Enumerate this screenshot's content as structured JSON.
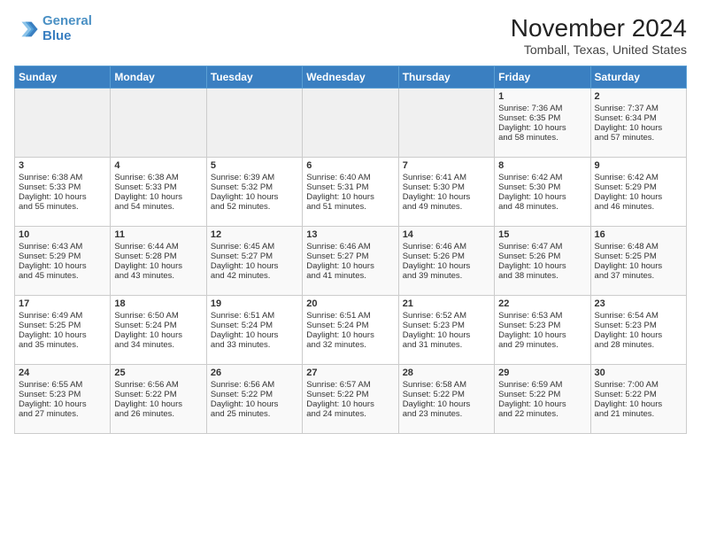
{
  "header": {
    "logo_line1": "General",
    "logo_line2": "Blue",
    "month": "November 2024",
    "location": "Tomball, Texas, United States"
  },
  "weekdays": [
    "Sunday",
    "Monday",
    "Tuesday",
    "Wednesday",
    "Thursday",
    "Friday",
    "Saturday"
  ],
  "weeks": [
    [
      {
        "day": "",
        "info": ""
      },
      {
        "day": "",
        "info": ""
      },
      {
        "day": "",
        "info": ""
      },
      {
        "day": "",
        "info": ""
      },
      {
        "day": "",
        "info": ""
      },
      {
        "day": "1",
        "info": "Sunrise: 7:36 AM\nSunset: 6:35 PM\nDaylight: 10 hours\nand 58 minutes."
      },
      {
        "day": "2",
        "info": "Sunrise: 7:37 AM\nSunset: 6:34 PM\nDaylight: 10 hours\nand 57 minutes."
      }
    ],
    [
      {
        "day": "3",
        "info": "Sunrise: 6:38 AM\nSunset: 5:33 PM\nDaylight: 10 hours\nand 55 minutes."
      },
      {
        "day": "4",
        "info": "Sunrise: 6:38 AM\nSunset: 5:33 PM\nDaylight: 10 hours\nand 54 minutes."
      },
      {
        "day": "5",
        "info": "Sunrise: 6:39 AM\nSunset: 5:32 PM\nDaylight: 10 hours\nand 52 minutes."
      },
      {
        "day": "6",
        "info": "Sunrise: 6:40 AM\nSunset: 5:31 PM\nDaylight: 10 hours\nand 51 minutes."
      },
      {
        "day": "7",
        "info": "Sunrise: 6:41 AM\nSunset: 5:30 PM\nDaylight: 10 hours\nand 49 minutes."
      },
      {
        "day": "8",
        "info": "Sunrise: 6:42 AM\nSunset: 5:30 PM\nDaylight: 10 hours\nand 48 minutes."
      },
      {
        "day": "9",
        "info": "Sunrise: 6:42 AM\nSunset: 5:29 PM\nDaylight: 10 hours\nand 46 minutes."
      }
    ],
    [
      {
        "day": "10",
        "info": "Sunrise: 6:43 AM\nSunset: 5:29 PM\nDaylight: 10 hours\nand 45 minutes."
      },
      {
        "day": "11",
        "info": "Sunrise: 6:44 AM\nSunset: 5:28 PM\nDaylight: 10 hours\nand 43 minutes."
      },
      {
        "day": "12",
        "info": "Sunrise: 6:45 AM\nSunset: 5:27 PM\nDaylight: 10 hours\nand 42 minutes."
      },
      {
        "day": "13",
        "info": "Sunrise: 6:46 AM\nSunset: 5:27 PM\nDaylight: 10 hours\nand 41 minutes."
      },
      {
        "day": "14",
        "info": "Sunrise: 6:46 AM\nSunset: 5:26 PM\nDaylight: 10 hours\nand 39 minutes."
      },
      {
        "day": "15",
        "info": "Sunrise: 6:47 AM\nSunset: 5:26 PM\nDaylight: 10 hours\nand 38 minutes."
      },
      {
        "day": "16",
        "info": "Sunrise: 6:48 AM\nSunset: 5:25 PM\nDaylight: 10 hours\nand 37 minutes."
      }
    ],
    [
      {
        "day": "17",
        "info": "Sunrise: 6:49 AM\nSunset: 5:25 PM\nDaylight: 10 hours\nand 35 minutes."
      },
      {
        "day": "18",
        "info": "Sunrise: 6:50 AM\nSunset: 5:24 PM\nDaylight: 10 hours\nand 34 minutes."
      },
      {
        "day": "19",
        "info": "Sunrise: 6:51 AM\nSunset: 5:24 PM\nDaylight: 10 hours\nand 33 minutes."
      },
      {
        "day": "20",
        "info": "Sunrise: 6:51 AM\nSunset: 5:24 PM\nDaylight: 10 hours\nand 32 minutes."
      },
      {
        "day": "21",
        "info": "Sunrise: 6:52 AM\nSunset: 5:23 PM\nDaylight: 10 hours\nand 31 minutes."
      },
      {
        "day": "22",
        "info": "Sunrise: 6:53 AM\nSunset: 5:23 PM\nDaylight: 10 hours\nand 29 minutes."
      },
      {
        "day": "23",
        "info": "Sunrise: 6:54 AM\nSunset: 5:23 PM\nDaylight: 10 hours\nand 28 minutes."
      }
    ],
    [
      {
        "day": "24",
        "info": "Sunrise: 6:55 AM\nSunset: 5:23 PM\nDaylight: 10 hours\nand 27 minutes."
      },
      {
        "day": "25",
        "info": "Sunrise: 6:56 AM\nSunset: 5:22 PM\nDaylight: 10 hours\nand 26 minutes."
      },
      {
        "day": "26",
        "info": "Sunrise: 6:56 AM\nSunset: 5:22 PM\nDaylight: 10 hours\nand 25 minutes."
      },
      {
        "day": "27",
        "info": "Sunrise: 6:57 AM\nSunset: 5:22 PM\nDaylight: 10 hours\nand 24 minutes."
      },
      {
        "day": "28",
        "info": "Sunrise: 6:58 AM\nSunset: 5:22 PM\nDaylight: 10 hours\nand 23 minutes."
      },
      {
        "day": "29",
        "info": "Sunrise: 6:59 AM\nSunset: 5:22 PM\nDaylight: 10 hours\nand 22 minutes."
      },
      {
        "day": "30",
        "info": "Sunrise: 7:00 AM\nSunset: 5:22 PM\nDaylight: 10 hours\nand 21 minutes."
      }
    ]
  ]
}
